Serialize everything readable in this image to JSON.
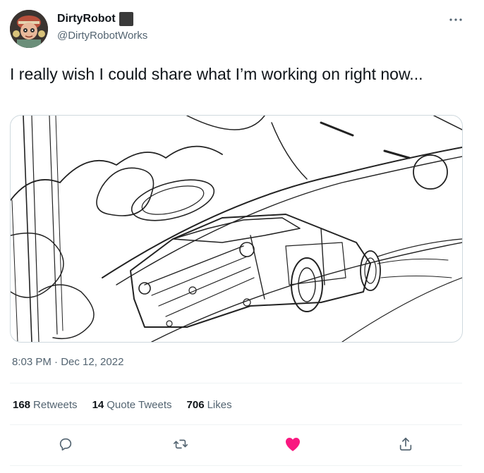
{
  "user": {
    "display_name": "DirtyRobot",
    "handle": "@DirtyRobotWorks",
    "avatar_icon": "avatar-illustration"
  },
  "tweet": {
    "text": "I really wish I could share what I’m working on right now...",
    "timestamp": "8:03 PM · Dec 12, 2022",
    "media_alt": "pencil sketch of a car drifting"
  },
  "stats": {
    "retweets_count": "168",
    "retweets_label": "Retweets",
    "quotes_count": "14",
    "quotes_label": "Quote Tweets",
    "likes_count": "706",
    "likes_label": "Likes"
  },
  "actions": [
    {
      "name": "reply",
      "icon": "reply-icon"
    },
    {
      "name": "retweet",
      "icon": "retweet-icon"
    },
    {
      "name": "like",
      "icon": "heart-icon",
      "liked": true
    },
    {
      "name": "share",
      "icon": "share-icon"
    }
  ],
  "colors": {
    "text_primary": "#0f1419",
    "text_secondary": "#536471",
    "like_active": "#f91880",
    "border": "#cfd9de"
  }
}
